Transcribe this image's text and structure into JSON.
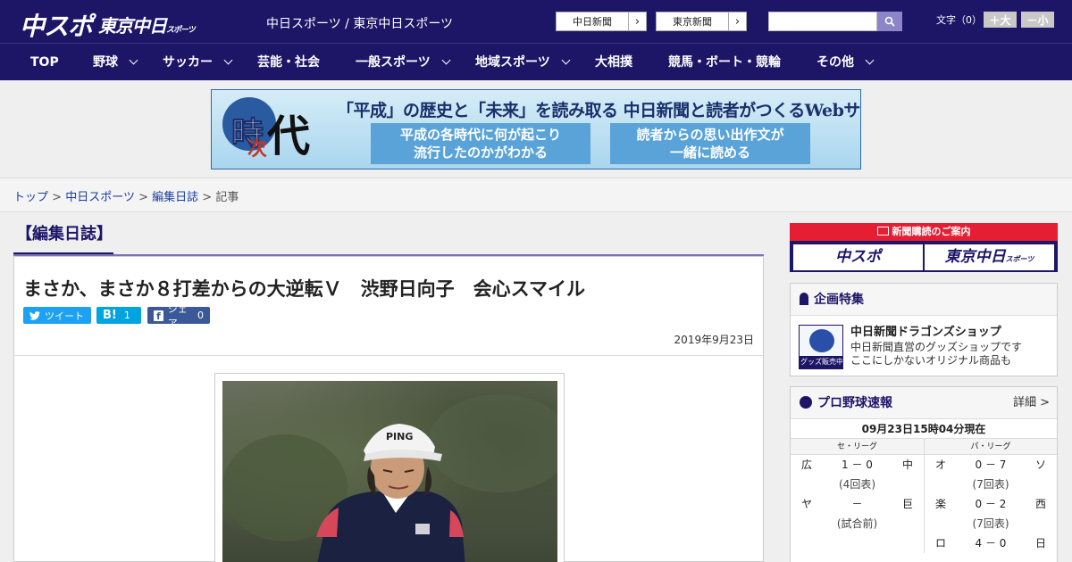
{
  "header": {
    "logo_primary": "中スポ",
    "logo_secondary": "東京中日",
    "logo_secondary_small": "スポーツ",
    "site_links": "中日スポーツ / 東京中日スポーツ",
    "ext_buttons": [
      "中日新聞",
      "東京新聞"
    ],
    "search_placeholder": "",
    "font_size_label": "文字（0）",
    "font_bigger": "＋大",
    "font_smaller": "－小"
  },
  "nav": {
    "items": [
      "TOP",
      "野球",
      "サッカー",
      "芸能・社会",
      "一般スポーツ",
      "地域スポーツ",
      "大相撲",
      "競馬・ボート・競輪",
      "その他"
    ]
  },
  "banner": {
    "headline": "「平成」の歴史と「未来」を読み取る 中日新聞と読者がつくるWebサイト",
    "box1": "平成の各時代に何が起こり流行したのかがわかる",
    "box1_line1": "平成の各時代に何が起こり",
    "box1_line2": "流行したのかがわかる",
    "box2_line1": "読者からの思い出作文が",
    "box2_line2": "一緒に読める",
    "logo_chars": [
      "時",
      "次",
      "代"
    ]
  },
  "breadcrumb": {
    "items": [
      "トップ",
      "中日スポーツ",
      "編集日誌",
      "記事"
    ],
    "separator": ">"
  },
  "article": {
    "category": "【編集日誌】",
    "headline": "まさか、まさか８打差からの大逆転Ｖ　渋野日向子　会心スマイル",
    "share": {
      "tweet": "ツイート",
      "hatena_count": "1",
      "facebook_label": "シェア",
      "facebook_count": "0"
    },
    "date": "2019年9月23日",
    "photo_cap_text": "PING"
  },
  "sidebar": {
    "subscribe": {
      "heading": "新聞購読のご案内",
      "btn1": "中スポ",
      "btn2": "東京中日",
      "btn2_small": "スポーツ"
    },
    "feature": {
      "heading": "企画特集",
      "shop_badge": "グッズ販売中",
      "title": "中日新聞ドラゴンズショップ",
      "desc1": "中日新聞直営のグッズショップです",
      "desc2": "ここにしかないオリジナル商品も"
    },
    "baseball": {
      "heading": "プロ野球速報",
      "detail": "詳細 >",
      "time": "09月23日15時04分現在",
      "central": {
        "label": "セ・リーグ",
        "games": [
          {
            "home": "広",
            "score": "1 － 0",
            "away": "中",
            "status": "(4回表)"
          },
          {
            "home": "ヤ",
            "score": "－",
            "away": "巨",
            "status": "(試合前)"
          }
        ]
      },
      "pacific": {
        "label": "パ・リーグ",
        "games": [
          {
            "home": "オ",
            "score": "0 － 7",
            "away": "ソ",
            "status": "(7回表)"
          },
          {
            "home": "楽",
            "score": "0 － 2",
            "away": "西",
            "status": "(7回表)"
          },
          {
            "home": "ロ",
            "score": "4 － 0",
            "away": "日",
            "status": ""
          }
        ]
      }
    }
  },
  "colors": {
    "brand_navy": "#1d1566",
    "accent_red": "#e61e33",
    "twitter": "#1da1f2",
    "hatena": "#00a4de",
    "facebook": "#3b5998"
  }
}
